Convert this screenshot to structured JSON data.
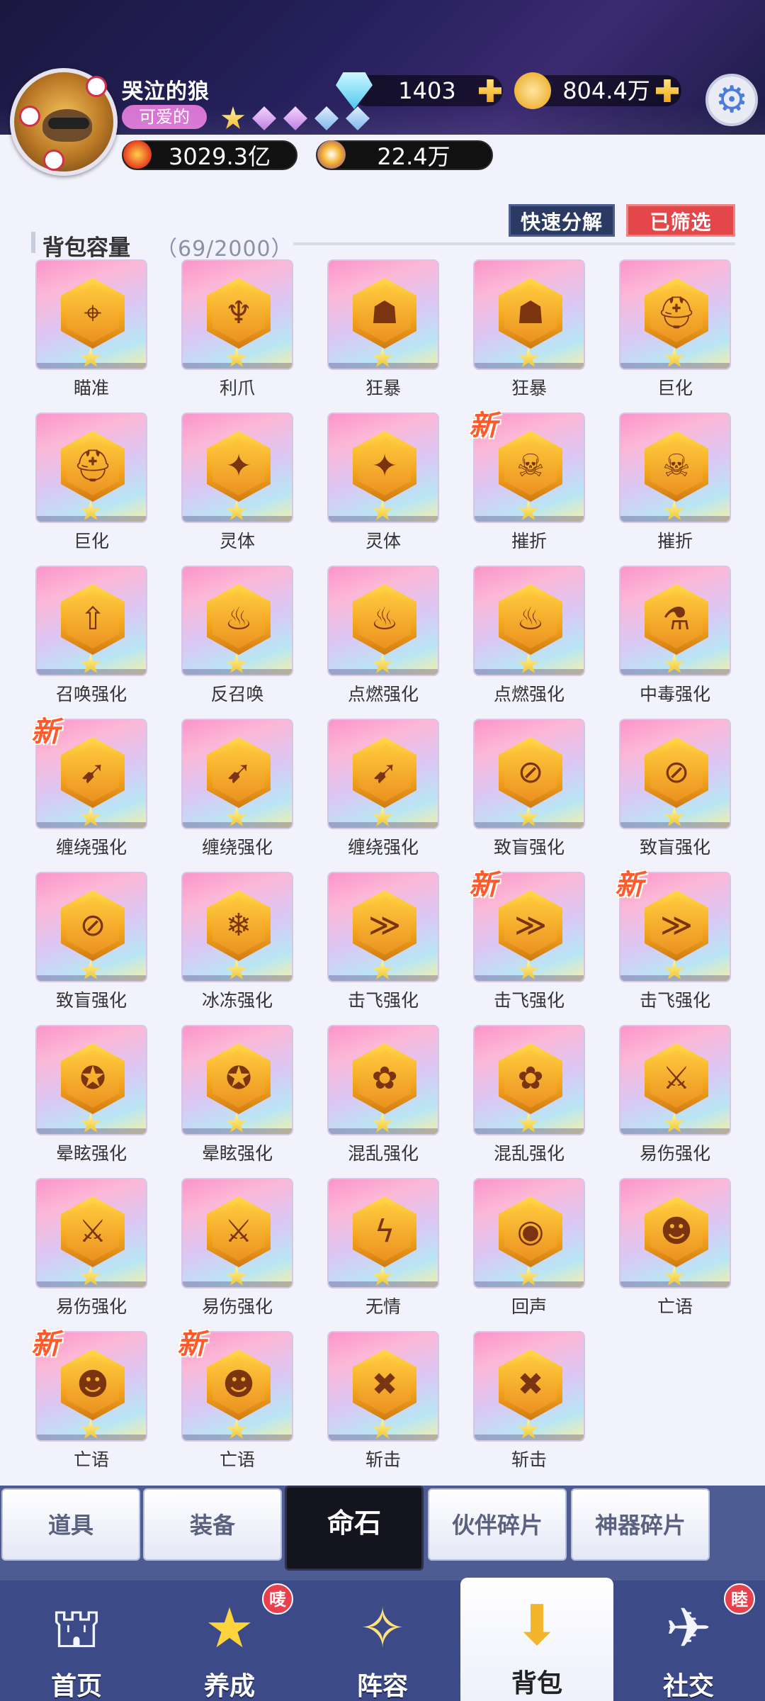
{
  "player": {
    "name": "哭泣的狼",
    "title": "可爱的",
    "power": "3029.3亿",
    "stardust": "22.4万"
  },
  "resources": {
    "diamonds": "1403",
    "gold": "804.4万"
  },
  "actions": {
    "decompose_label": "快速分解",
    "filter_label": "已筛选"
  },
  "capacity": {
    "label": "背包容量",
    "value": "（69/2000）"
  },
  "new_badge": "新",
  "items": [
    {
      "label": "瞄准",
      "icon": "crosshair-icon",
      "glyph": "⌖",
      "new": false
    },
    {
      "label": "利爪",
      "icon": "claw-icon",
      "glyph": "♆",
      "new": false
    },
    {
      "label": "狂暴",
      "icon": "rage-face-icon",
      "glyph": "☗",
      "new": false
    },
    {
      "label": "狂暴",
      "icon": "rage-face-icon",
      "glyph": "☗",
      "new": false
    },
    {
      "label": "巨化",
      "icon": "giant-helmet-icon",
      "glyph": "⛑",
      "new": false
    },
    {
      "label": "巨化",
      "icon": "giant-helmet-icon",
      "glyph": "⛑",
      "new": false
    },
    {
      "label": "灵体",
      "icon": "spirit-icon",
      "glyph": "✦",
      "new": false
    },
    {
      "label": "灵体",
      "icon": "spirit-icon",
      "glyph": "✦",
      "new": false
    },
    {
      "label": "摧折",
      "icon": "demon-drum-icon",
      "glyph": "☠",
      "new": true
    },
    {
      "label": "摧折",
      "icon": "demon-drum-icon",
      "glyph": "☠",
      "new": false
    },
    {
      "label": "召唤强化",
      "icon": "summon-up-icon",
      "glyph": "⇧",
      "new": false
    },
    {
      "label": "反召唤",
      "icon": "unsummon-icon",
      "glyph": "♨",
      "new": false
    },
    {
      "label": "点燃强化",
      "icon": "ignite-icon",
      "glyph": "♨",
      "new": false
    },
    {
      "label": "点燃强化",
      "icon": "ignite-icon",
      "glyph": "♨",
      "new": false
    },
    {
      "label": "中毒强化",
      "icon": "poison-flask-icon",
      "glyph": "⚗",
      "new": false
    },
    {
      "label": "缠绕强化",
      "icon": "entangle-icon",
      "glyph": "➹",
      "new": true
    },
    {
      "label": "缠绕强化",
      "icon": "entangle-icon",
      "glyph": "➹",
      "new": false
    },
    {
      "label": "缠绕强化",
      "icon": "entangle-icon",
      "glyph": "➹",
      "new": false
    },
    {
      "label": "致盲强化",
      "icon": "blind-icon",
      "glyph": "⊘",
      "new": false
    },
    {
      "label": "致盲强化",
      "icon": "blind-icon",
      "glyph": "⊘",
      "new": false
    },
    {
      "label": "致盲强化",
      "icon": "blind-icon",
      "glyph": "⊘",
      "new": false
    },
    {
      "label": "冰冻强化",
      "icon": "snowflake-icon",
      "glyph": "❄",
      "new": false
    },
    {
      "label": "击飞强化",
      "icon": "knockup-icon",
      "glyph": "≫",
      "new": false
    },
    {
      "label": "击飞强化",
      "icon": "knockup-icon",
      "glyph": "≫",
      "new": true
    },
    {
      "label": "击飞强化",
      "icon": "knockup-icon",
      "glyph": "≫",
      "new": true
    },
    {
      "label": "晕眩强化",
      "icon": "stun-icon",
      "glyph": "✪",
      "new": false
    },
    {
      "label": "晕眩强化",
      "icon": "stun-icon",
      "glyph": "✪",
      "new": false
    },
    {
      "label": "混乱强化",
      "icon": "confuse-icon",
      "glyph": "✿",
      "new": false
    },
    {
      "label": "混乱强化",
      "icon": "confuse-icon",
      "glyph": "✿",
      "new": false
    },
    {
      "label": "易伤强化",
      "icon": "vulnerable-sword-icon",
      "glyph": "⚔",
      "new": false
    },
    {
      "label": "易伤强化",
      "icon": "vulnerable-sword-icon",
      "glyph": "⚔",
      "new": false
    },
    {
      "label": "易伤强化",
      "icon": "vulnerable-sword-icon",
      "glyph": "⚔",
      "new": false
    },
    {
      "label": "无情",
      "icon": "ruthless-icon",
      "glyph": "ϟ",
      "new": false
    },
    {
      "label": "回声",
      "icon": "echo-icon",
      "glyph": "◉",
      "new": false
    },
    {
      "label": "亡语",
      "icon": "deathrattle-icon",
      "glyph": "☻",
      "new": false
    },
    {
      "label": "亡语",
      "icon": "deathrattle-icon",
      "glyph": "☻",
      "new": true
    },
    {
      "label": "亡语",
      "icon": "deathrattle-icon",
      "glyph": "☻",
      "new": true
    },
    {
      "label": "斩击",
      "icon": "slash-icon",
      "glyph": "✖",
      "new": false
    },
    {
      "label": "斩击",
      "icon": "slash-icon",
      "glyph": "✖",
      "new": false
    }
  ],
  "category_tabs": [
    {
      "label": "道具",
      "active": false
    },
    {
      "label": "装备",
      "active": false
    },
    {
      "label": "命石",
      "active": true
    },
    {
      "label": "伙伴碎片",
      "active": false
    },
    {
      "label": "神器碎片",
      "active": false
    }
  ],
  "bottom_nav": [
    {
      "label": "首页",
      "icon": "home-castle-icon",
      "glyph": "⛫",
      "badge": ""
    },
    {
      "label": "养成",
      "icon": "star-growth-icon",
      "glyph": "★",
      "badge": "唛"
    },
    {
      "label": "阵容",
      "icon": "lineup-icon",
      "glyph": "✧",
      "badge": ""
    },
    {
      "label": "背包",
      "icon": "backpack-icon",
      "glyph": "⬇",
      "badge": ""
    },
    {
      "label": "社交",
      "icon": "social-icon",
      "glyph": "✈",
      "badge": "睦"
    }
  ],
  "colors": {
    "header_bg": "#24205a",
    "tab_active_bg": "#14141f",
    "nav_bg": "#3d4a88",
    "new_badge": "#ff5a2c",
    "filter_button": "#e4474a",
    "badge_red": "#e8404c"
  }
}
